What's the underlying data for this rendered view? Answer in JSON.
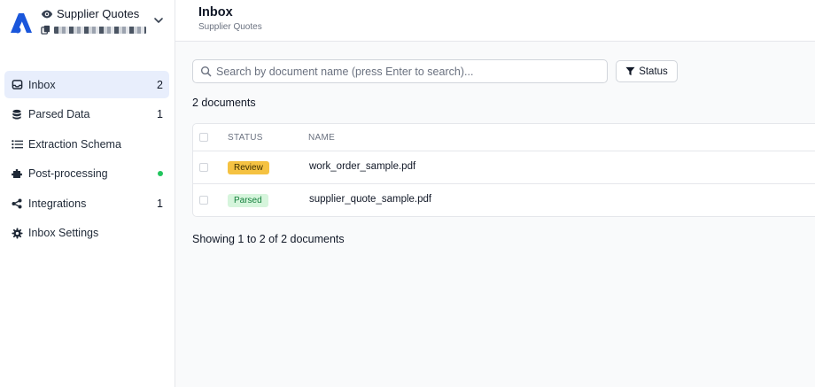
{
  "brand": {
    "title": "Supplier Quotes",
    "colors": {
      "logo": "#1a56db"
    }
  },
  "sidebar": {
    "items": [
      {
        "label": "Inbox",
        "icon": "inbox-icon",
        "count": "2",
        "active": true
      },
      {
        "label": "Parsed Data",
        "icon": "database-icon",
        "count": "1"
      },
      {
        "label": "Extraction Schema",
        "icon": "list-icon"
      },
      {
        "label": "Post-processing",
        "icon": "puzzle-icon",
        "status_dot": "#22c55e"
      },
      {
        "label": "Integrations",
        "icon": "share-icon",
        "count": "1"
      },
      {
        "label": "Inbox Settings",
        "icon": "gear-icon"
      }
    ]
  },
  "header": {
    "title": "Inbox",
    "subtitle": "Supplier Quotes"
  },
  "search": {
    "placeholder": "Search by document name (press Enter to search)..."
  },
  "filters": {
    "status_label": "Status"
  },
  "documents": {
    "count_text": "2 documents",
    "columns": [
      "STATUS",
      "NAME"
    ],
    "rows": [
      {
        "status": "Review",
        "status_color": "#f5c242",
        "name": "work_order_sample.pdf"
      },
      {
        "status": "Parsed",
        "status_color": "#d6f5dc",
        "name": "supplier_quote_sample.pdf"
      }
    ],
    "pagination_text": "Showing 1 to 2 of 2 documents"
  }
}
